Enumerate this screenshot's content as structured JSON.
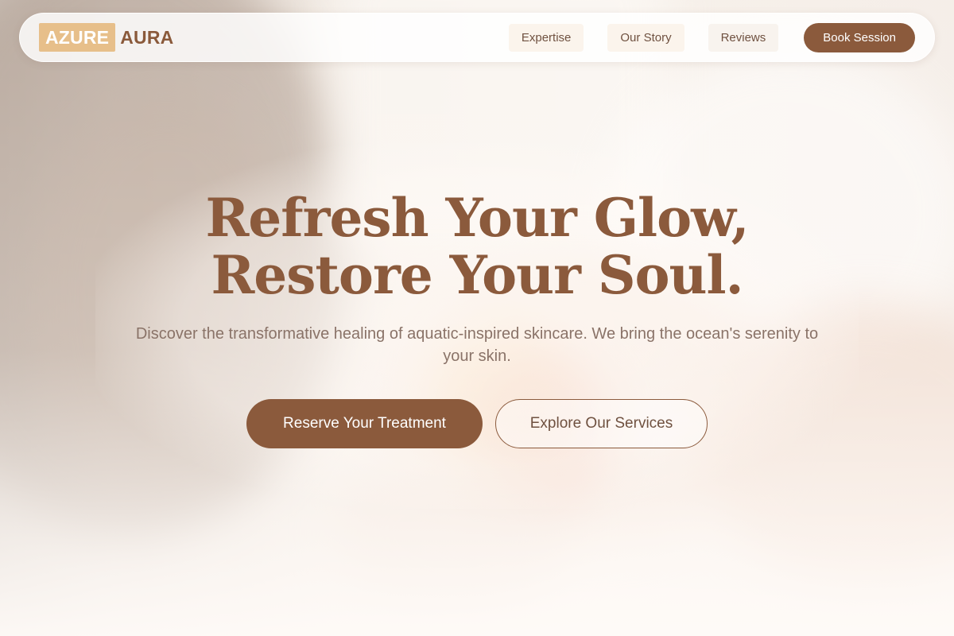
{
  "brand": {
    "badge": "AZURE",
    "word": "AURA",
    "badge_color": "#e7bf8a",
    "primary_color": "#8b5a3c"
  },
  "nav": {
    "links": [
      {
        "label": "Expertise"
      },
      {
        "label": "Our Story"
      },
      {
        "label": "Reviews"
      }
    ],
    "cta_label": "Book Session"
  },
  "hero": {
    "title_line1": "Refresh Your Glow,",
    "title_line2": "Restore Your Soul.",
    "subtitle": "Discover the transformative healing of aquatic-inspired skincare. We bring the ocean's serenity to your skin.",
    "primary_cta": "Reserve Your Treatment",
    "secondary_cta": "Explore Our Services"
  }
}
